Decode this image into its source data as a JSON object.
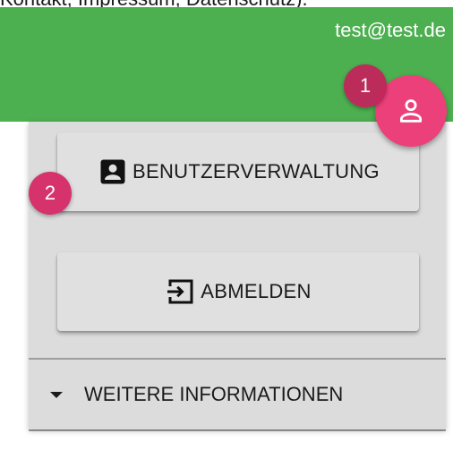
{
  "caption": {
    "text": "Kontakt, Impressum, Datenschutz)."
  },
  "header": {
    "email": "test@test.de",
    "avatar_icon": "person-outline-icon",
    "background": "#4caf50",
    "accent": "#ec407a"
  },
  "markers": {
    "first": "1",
    "second": "2"
  },
  "menu": {
    "admin_label": "BENUTZERVERWALTUNG",
    "admin_icon": "account-box-icon",
    "logout_label": "ABMELDEN",
    "logout_icon": "logout-icon",
    "more_label": "WEITERE INFORMATIONEN",
    "more_icon": "caret-down-icon"
  }
}
